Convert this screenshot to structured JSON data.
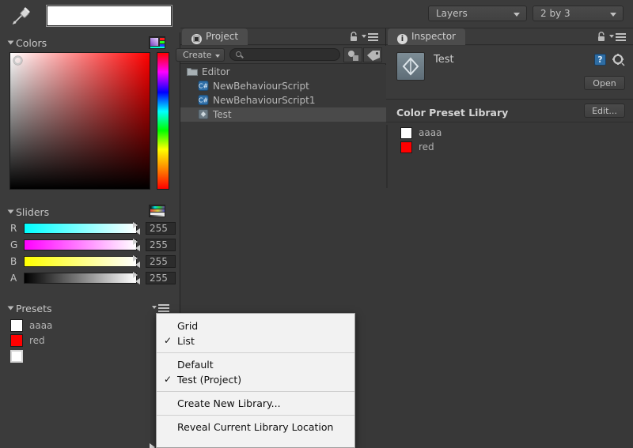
{
  "toolbar": {
    "layers_dropdown": "Layers",
    "layout_dropdown": "2 by 3"
  },
  "color_picker": {
    "eyedropper_icon": "eyedropper-icon",
    "current_color_hex": "#ffffff",
    "colors_section": {
      "label": "Colors",
      "mode_icon": "palette-icon",
      "hue_degrees": 0,
      "saturation": 0,
      "value": 100
    },
    "sliders_section": {
      "label": "Sliders",
      "mode_icon": "slider-mode-icon",
      "channels": [
        {
          "name": "R",
          "value": "255",
          "from": "#00ffff",
          "to": "#ffffff"
        },
        {
          "name": "G",
          "value": "255",
          "from": "#ff00ff",
          "to": "#ffffff"
        },
        {
          "name": "B",
          "value": "255",
          "from": "#ffff00",
          "to": "#ffffff"
        },
        {
          "name": "A",
          "value": "255",
          "from": "#000000",
          "to": "#ffffff"
        }
      ]
    },
    "presets_section": {
      "label": "Presets",
      "menu_icon": "options-menu-icon",
      "items": [
        {
          "name": "aaaa",
          "color": "#ffffff"
        },
        {
          "name": "red",
          "color": "#ff0000"
        }
      ],
      "add_swatch_color": "#ffffff"
    }
  },
  "project_panel": {
    "tab_label": "Project",
    "tab_icon": "project-icon",
    "lock_icon": "lock-icon",
    "menu_icon": "panel-menu-icon",
    "create_button": "Create",
    "search_placeholder": "",
    "search_value": "",
    "search_icon": "search-icon",
    "filter_type_icon": "filter-by-type-icon",
    "filter_label_icon": "filter-by-label-icon",
    "tree": [
      {
        "label": "Editor",
        "icon": "folder-icon",
        "indent": 0,
        "selected": false
      },
      {
        "label": "NewBehaviourScript",
        "icon": "csharp-script-icon",
        "indent": 1,
        "selected": false
      },
      {
        "label": "NewBehaviourScript1",
        "icon": "csharp-script-icon",
        "indent": 1,
        "selected": false
      },
      {
        "label": "Test",
        "icon": "unity-asset-icon",
        "indent": 1,
        "selected": true
      }
    ]
  },
  "inspector_panel": {
    "tab_label": "Inspector",
    "tab_icon": "info-icon",
    "lock_icon": "lock-icon",
    "menu_icon": "panel-menu-icon",
    "asset_name": "Test",
    "asset_icon": "unity-asset-icon",
    "help_icon": "help-book-icon",
    "gear_icon": "gear-icon",
    "open_button": "Open",
    "component_title": "Color Preset Library",
    "edit_button": "Edit...",
    "presets": [
      {
        "name": "aaaa",
        "color": "#ffffff"
      },
      {
        "name": "red",
        "color": "#ff0000"
      }
    ]
  },
  "context_menu": {
    "items": [
      {
        "label": "Grid",
        "checked": false
      },
      {
        "label": "List",
        "checked": true
      },
      {
        "label": "Default",
        "checked": false
      },
      {
        "label": "Test (Project)",
        "checked": true
      },
      {
        "label": "Create New Library...",
        "checked": false
      },
      {
        "label": "Reveal Current Library Location",
        "checked": false
      }
    ],
    "check_glyph": "✓"
  },
  "colors": {
    "panel_bg": "#3b3b3b",
    "panel_bg_alt": "#383838",
    "menu_bg": "#f2f2f2",
    "selection": "#4a4a4a",
    "text": "#b4b4b4"
  }
}
